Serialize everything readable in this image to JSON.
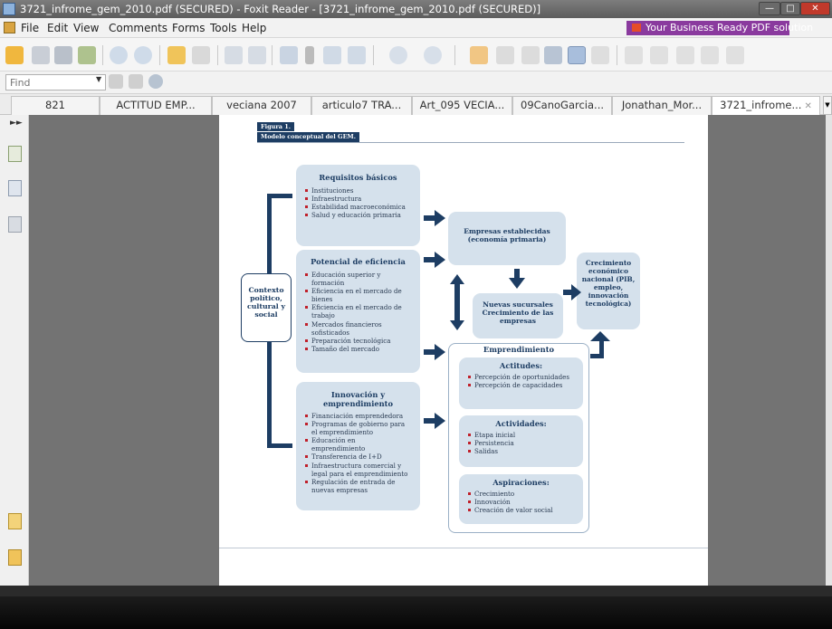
{
  "window": {
    "title": "3721_infrome_gem_2010.pdf (SECURED) - Foxit Reader - [3721_infrome_gem_2010.pdf (SECURED)]"
  },
  "menu": {
    "items": [
      "File",
      "Edit",
      "View",
      "Comments",
      "Forms",
      "Tools",
      "Help"
    ],
    "ad": "Your Business Ready PDF solution"
  },
  "find": {
    "placeholder": "Find"
  },
  "tabs": [
    {
      "label": "821"
    },
    {
      "label": "ACTITUD EMP..."
    },
    {
      "label": "veciana 2007"
    },
    {
      "label": "articulo7 TRA..."
    },
    {
      "label": "Art_095 VECIA..."
    },
    {
      "label": "09CanoGarcia..."
    },
    {
      "label": "Jonathan_Mor..."
    },
    {
      "label": "3721_infrome..."
    }
  ],
  "figure": {
    "label": "Figura 1.",
    "title": "Modelo conceptual del GEM.",
    "contexto": "Contexto político, cultural y social",
    "requisitos": {
      "title": "Requisitos básicos",
      "items": [
        "Instituciones",
        "Infraestructura",
        "Estabilidad macroeconómica",
        "Salud y educación primaria"
      ]
    },
    "eficiencia": {
      "title": "Potencial de eficiencia",
      "items": [
        "Educación superior y formación",
        "Eficiencia en el mercado de bienes",
        "Eficiencia en el mercado de trabajo",
        "Mercados financieros sofisticados",
        "Preparación tecnológica",
        "Tamaño del mercado"
      ]
    },
    "innovacion": {
      "title": "Innovación y emprendimiento",
      "items": [
        "Financiación emprendedora",
        "Programas de gobierno para el emprendimiento",
        "Educación en emprendimiento",
        "Transferencia de I+D",
        "Infraestructura comercial y legal para el emprendimiento",
        "Regulación de entrada de nuevas empresas"
      ]
    },
    "establecidas": "Empresas establecidas (economía primaria)",
    "sucursales": "Nuevas sucursales Crecimiento de las empresas",
    "crecimiento": "Crecimiento económico nacional (PIB, empleo, innovación tecnológica)",
    "emprendimiento": {
      "title": "Emprendimiento",
      "actitudes": {
        "title": "Actitudes:",
        "items": [
          "Percepción de oportunidades",
          "Percepción de capacidades"
        ]
      },
      "actividades": {
        "title": "Actividades:",
        "items": [
          "Etapa inicial",
          "Persistencia",
          "Salidas"
        ]
      },
      "aspiraciones": {
        "title": "Aspiraciones:",
        "items": [
          "Crecimiento",
          "Innovación",
          "Creación de valor social"
        ]
      }
    }
  },
  "colors": {
    "navy": "#1d3d63",
    "box": "#d5e1ec",
    "bullet": "#c0202a",
    "ad": "#8a3a9e"
  },
  "icons": [
    "open-icon",
    "save-icon",
    "print-icon",
    "email-icon",
    "prev-page-icon",
    "next-page-icon",
    "back-icon",
    "forward-icon",
    "hand-icon",
    "select-icon",
    "zoom-in-icon",
    "zoom-out-icon"
  ]
}
